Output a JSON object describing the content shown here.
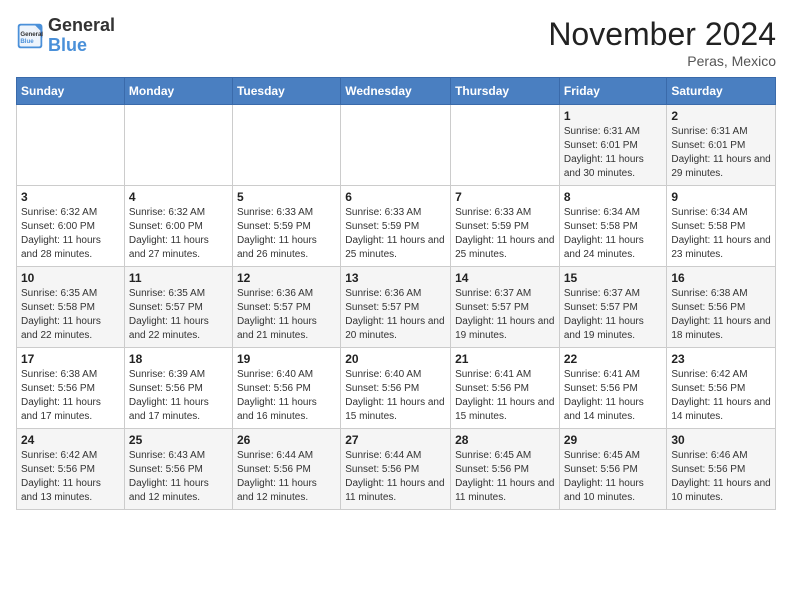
{
  "logo": {
    "line1": "General",
    "line2": "Blue"
  },
  "title": "November 2024",
  "location": "Peras, Mexico",
  "days_of_week": [
    "Sunday",
    "Monday",
    "Tuesday",
    "Wednesday",
    "Thursday",
    "Friday",
    "Saturday"
  ],
  "weeks": [
    [
      {
        "day": "",
        "info": ""
      },
      {
        "day": "",
        "info": ""
      },
      {
        "day": "",
        "info": ""
      },
      {
        "day": "",
        "info": ""
      },
      {
        "day": "",
        "info": ""
      },
      {
        "day": "1",
        "info": "Sunrise: 6:31 AM\nSunset: 6:01 PM\nDaylight: 11 hours and 30 minutes."
      },
      {
        "day": "2",
        "info": "Sunrise: 6:31 AM\nSunset: 6:01 PM\nDaylight: 11 hours and 29 minutes."
      }
    ],
    [
      {
        "day": "3",
        "info": "Sunrise: 6:32 AM\nSunset: 6:00 PM\nDaylight: 11 hours and 28 minutes."
      },
      {
        "day": "4",
        "info": "Sunrise: 6:32 AM\nSunset: 6:00 PM\nDaylight: 11 hours and 27 minutes."
      },
      {
        "day": "5",
        "info": "Sunrise: 6:33 AM\nSunset: 5:59 PM\nDaylight: 11 hours and 26 minutes."
      },
      {
        "day": "6",
        "info": "Sunrise: 6:33 AM\nSunset: 5:59 PM\nDaylight: 11 hours and 25 minutes."
      },
      {
        "day": "7",
        "info": "Sunrise: 6:33 AM\nSunset: 5:59 PM\nDaylight: 11 hours and 25 minutes."
      },
      {
        "day": "8",
        "info": "Sunrise: 6:34 AM\nSunset: 5:58 PM\nDaylight: 11 hours and 24 minutes."
      },
      {
        "day": "9",
        "info": "Sunrise: 6:34 AM\nSunset: 5:58 PM\nDaylight: 11 hours and 23 minutes."
      }
    ],
    [
      {
        "day": "10",
        "info": "Sunrise: 6:35 AM\nSunset: 5:58 PM\nDaylight: 11 hours and 22 minutes."
      },
      {
        "day": "11",
        "info": "Sunrise: 6:35 AM\nSunset: 5:57 PM\nDaylight: 11 hours and 22 minutes."
      },
      {
        "day": "12",
        "info": "Sunrise: 6:36 AM\nSunset: 5:57 PM\nDaylight: 11 hours and 21 minutes."
      },
      {
        "day": "13",
        "info": "Sunrise: 6:36 AM\nSunset: 5:57 PM\nDaylight: 11 hours and 20 minutes."
      },
      {
        "day": "14",
        "info": "Sunrise: 6:37 AM\nSunset: 5:57 PM\nDaylight: 11 hours and 19 minutes."
      },
      {
        "day": "15",
        "info": "Sunrise: 6:37 AM\nSunset: 5:57 PM\nDaylight: 11 hours and 19 minutes."
      },
      {
        "day": "16",
        "info": "Sunrise: 6:38 AM\nSunset: 5:56 PM\nDaylight: 11 hours and 18 minutes."
      }
    ],
    [
      {
        "day": "17",
        "info": "Sunrise: 6:38 AM\nSunset: 5:56 PM\nDaylight: 11 hours and 17 minutes."
      },
      {
        "day": "18",
        "info": "Sunrise: 6:39 AM\nSunset: 5:56 PM\nDaylight: 11 hours and 17 minutes."
      },
      {
        "day": "19",
        "info": "Sunrise: 6:40 AM\nSunset: 5:56 PM\nDaylight: 11 hours and 16 minutes."
      },
      {
        "day": "20",
        "info": "Sunrise: 6:40 AM\nSunset: 5:56 PM\nDaylight: 11 hours and 15 minutes."
      },
      {
        "day": "21",
        "info": "Sunrise: 6:41 AM\nSunset: 5:56 PM\nDaylight: 11 hours and 15 minutes."
      },
      {
        "day": "22",
        "info": "Sunrise: 6:41 AM\nSunset: 5:56 PM\nDaylight: 11 hours and 14 minutes."
      },
      {
        "day": "23",
        "info": "Sunrise: 6:42 AM\nSunset: 5:56 PM\nDaylight: 11 hours and 14 minutes."
      }
    ],
    [
      {
        "day": "24",
        "info": "Sunrise: 6:42 AM\nSunset: 5:56 PM\nDaylight: 11 hours and 13 minutes."
      },
      {
        "day": "25",
        "info": "Sunrise: 6:43 AM\nSunset: 5:56 PM\nDaylight: 11 hours and 12 minutes."
      },
      {
        "day": "26",
        "info": "Sunrise: 6:44 AM\nSunset: 5:56 PM\nDaylight: 11 hours and 12 minutes."
      },
      {
        "day": "27",
        "info": "Sunrise: 6:44 AM\nSunset: 5:56 PM\nDaylight: 11 hours and 11 minutes."
      },
      {
        "day": "28",
        "info": "Sunrise: 6:45 AM\nSunset: 5:56 PM\nDaylight: 11 hours and 11 minutes."
      },
      {
        "day": "29",
        "info": "Sunrise: 6:45 AM\nSunset: 5:56 PM\nDaylight: 11 hours and 10 minutes."
      },
      {
        "day": "30",
        "info": "Sunrise: 6:46 AM\nSunset: 5:56 PM\nDaylight: 11 hours and 10 minutes."
      }
    ]
  ]
}
